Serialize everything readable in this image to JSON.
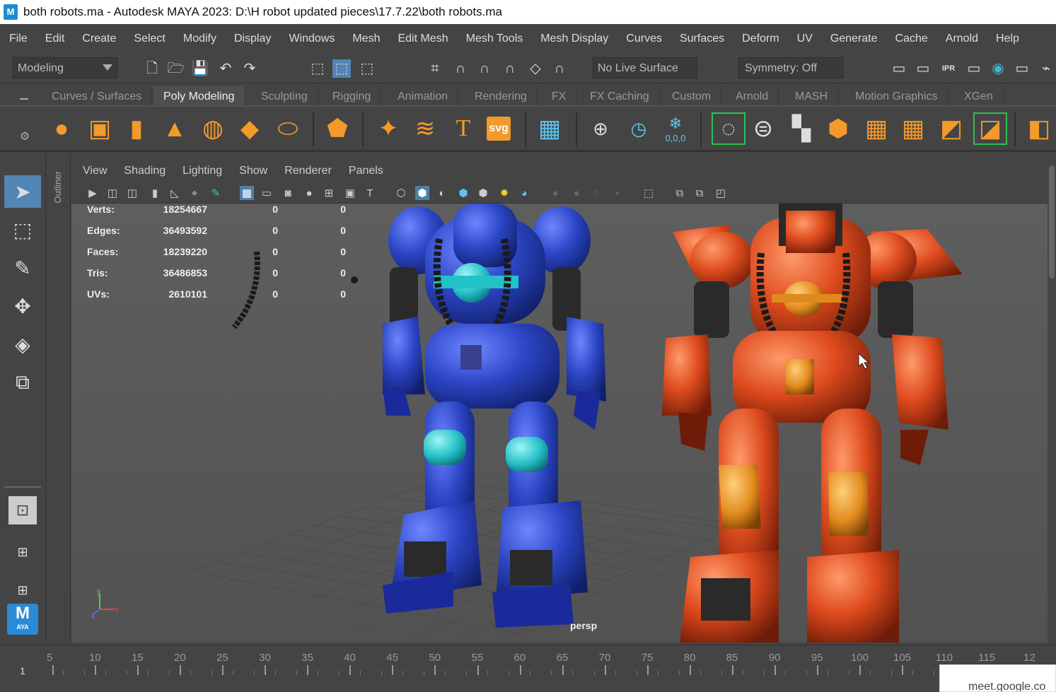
{
  "window": {
    "title": "both robots.ma - Autodesk MAYA 2023: D:\\H robot updated pieces\\17.7.22\\both robots.ma",
    "logo": "M"
  },
  "menu": [
    "File",
    "Edit",
    "Create",
    "Select",
    "Modify",
    "Display",
    "Windows",
    "Mesh",
    "Edit Mesh",
    "Mesh Tools",
    "Mesh Display",
    "Curves",
    "Surfaces",
    "Deform",
    "UV",
    "Generate",
    "Cache",
    "Arnold",
    "Help"
  ],
  "status": {
    "mode": "Modeling",
    "live_surface": "No Live Surface",
    "symmetry": "Symmetry: Off"
  },
  "shelf_tabs": [
    {
      "label": "Curves / Surfaces",
      "active": false
    },
    {
      "label": "Poly Modeling",
      "active": true
    },
    {
      "label": "Sculpting",
      "active": false
    },
    {
      "label": "Rigging",
      "active": false
    },
    {
      "label": "Animation",
      "active": false
    },
    {
      "label": "Rendering",
      "active": false
    },
    {
      "label": "FX",
      "active": false
    },
    {
      "label": "FX Caching",
      "active": false
    },
    {
      "label": "Custom",
      "active": false
    },
    {
      "label": "Arnold",
      "active": false
    },
    {
      "label": "MASH",
      "active": false
    },
    {
      "label": "Motion Graphics",
      "active": false
    },
    {
      "label": "XGen",
      "active": false
    }
  ],
  "shelf_text": {
    "text_tool": "T",
    "svg_tool": "svg",
    "coords": "0,0,0"
  },
  "outliner_label": "Outliner",
  "panel_menu": [
    "View",
    "Shading",
    "Lighting",
    "Show",
    "Renderer",
    "Panels"
  ],
  "hud": [
    {
      "label": "Verts:",
      "total": "18254667",
      "sel": "0",
      "comp": "0"
    },
    {
      "label": "Edges:",
      "total": "36493592",
      "sel": "0",
      "comp": "0"
    },
    {
      "label": "Faces:",
      "total": "18239220",
      "sel": "0",
      "comp": "0"
    },
    {
      "label": "Tris:",
      "total": "36486853",
      "sel": "0",
      "comp": "0"
    },
    {
      "label": "UVs:",
      "total": "2610101",
      "sel": "0",
      "comp": "0"
    }
  ],
  "camera_label": "persp",
  "axis": {
    "x": "x",
    "y": "y",
    "z": "z"
  },
  "timeline": {
    "current_frame": "1",
    "ticks": [
      "5",
      "10",
      "15",
      "20",
      "25",
      "30",
      "35",
      "40",
      "45",
      "50",
      "55",
      "60",
      "65",
      "70",
      "75",
      "80",
      "85",
      "90",
      "95",
      "100",
      "105",
      "110",
      "115",
      "12"
    ]
  },
  "meet_popup": "meet.google.co",
  "maya_logo": {
    "big": "M",
    "small": "AYA"
  },
  "colors": {
    "blue_robot": "#2f46c8",
    "blue_accent": "#23c2c8",
    "orange_robot": "#e0481c",
    "orange_accent": "#e08a1c",
    "viewport_bg": "#585858",
    "selection": "#5385b5"
  }
}
